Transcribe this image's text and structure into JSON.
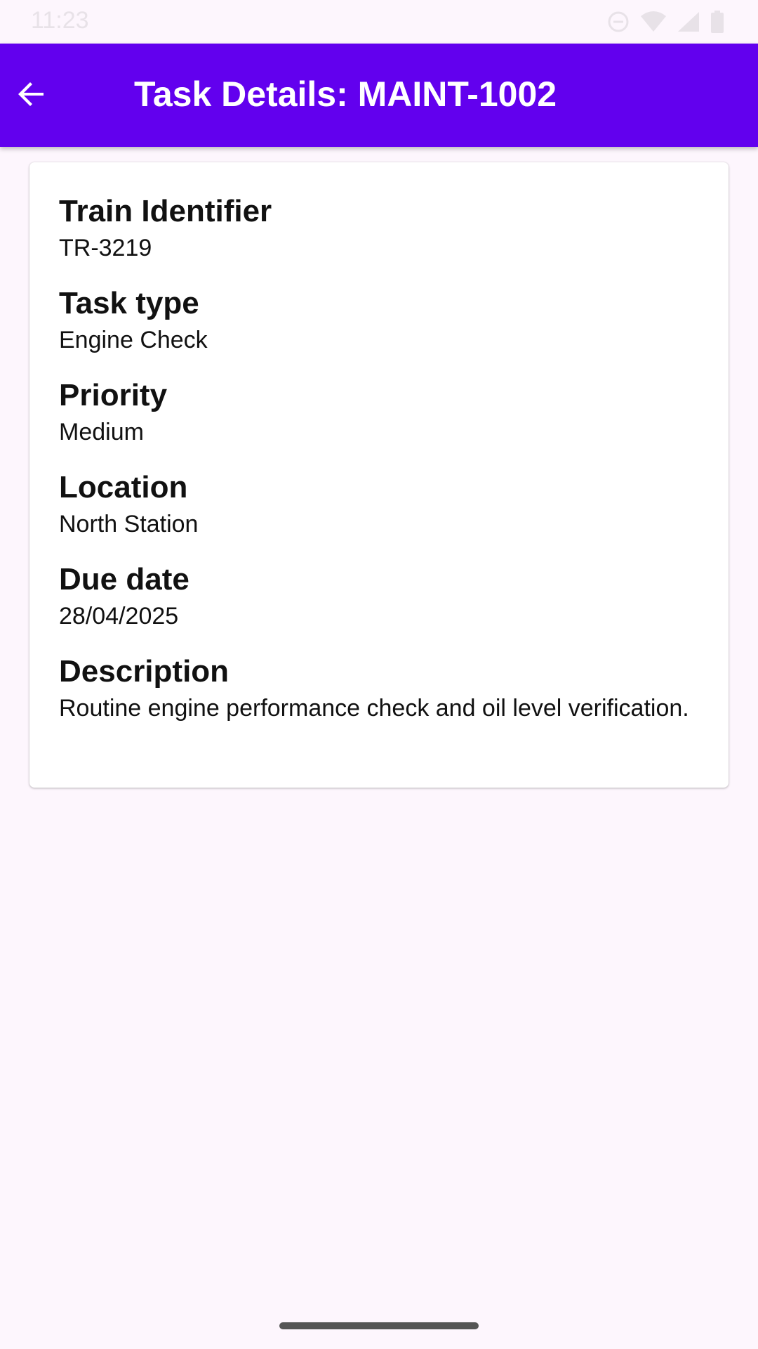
{
  "status_bar": {
    "time": "11:23",
    "icons": [
      "do-not-disturb-icon",
      "wifi-icon",
      "signal-icon",
      "battery-icon"
    ]
  },
  "app_bar": {
    "title": "Task Details: MAINT-1002",
    "back_icon": "arrow-back-icon",
    "background_color": "#6200ee"
  },
  "details": {
    "train_identifier": {
      "label": "Train Identifier",
      "value": "TR-3219"
    },
    "task_type": {
      "label": "Task type",
      "value": "Engine Check"
    },
    "priority": {
      "label": "Priority",
      "value": "Medium"
    },
    "location": {
      "label": "Location",
      "value": "North Station"
    },
    "due_date": {
      "label": "Due date",
      "value": "28/04/2025"
    },
    "description": {
      "label": "Description",
      "value": "Routine engine performance check and oil level verification."
    }
  }
}
